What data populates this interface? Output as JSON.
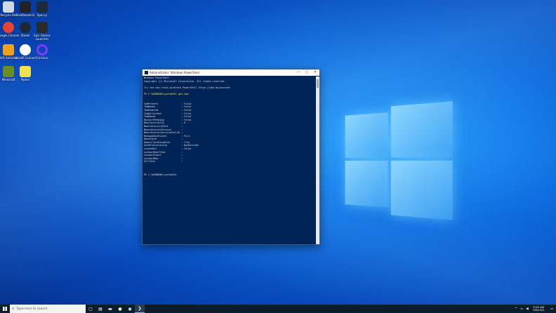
{
  "desktop": {
    "icons": [
      {
        "label": "Recycle Bin",
        "icon": "recycle-bin-icon",
        "color": "#cfd8e3"
      },
      {
        "label": "BestResearch",
        "icon": "app-icon",
        "color": "#222222"
      },
      {
        "label": "Speccy",
        "icon": "app-icon",
        "color": "#1b2a3a"
      },
      {
        "label": "Google Chrome",
        "icon": "chrome-icon",
        "color": "#e94235"
      },
      {
        "label": "Steam",
        "icon": "steam-icon",
        "color": "#1b2838"
      },
      {
        "label": "Epic Games Launcher",
        "icon": "epic-icon",
        "color": "#2a2a2a"
      },
      {
        "label": "AVG Antivirus",
        "icon": "shield-icon",
        "color": "#f0a020"
      },
      {
        "label": "Ubisoft Connect",
        "icon": "ubisoft-icon",
        "color": "#ffffff"
      },
      {
        "label": "Cortana",
        "icon": "ring-icon",
        "color": "#7a3cff"
      },
      {
        "label": "Minecraft",
        "icon": "cube-icon",
        "color": "#6b8e23"
      },
      {
        "label": "Notes",
        "icon": "file-icon",
        "color": "#f4e04d"
      }
    ]
  },
  "powershell": {
    "title": "Administrator: Windows PowerShell",
    "lines": [
      {
        "text": "Windows PowerShell",
        "style": ""
      },
      {
        "text": "Copyright (C) Microsoft Corporation. All rights reserved.",
        "style": ""
      },
      {
        "text": "",
        "style": ""
      },
      {
        "text": "Try the new cross-platform PowerShell https://aka.ms/pscore6",
        "style": ""
      },
      {
        "text": "",
        "style": ""
      },
      {
        "text": "PS C:\\WINDOWS\\system32> get-tpm",
        "style": "yel"
      },
      {
        "text": "",
        "style": ""
      },
      {
        "text": "",
        "style": ""
      },
      {
        "text": "TpmPresent                : False",
        "style": ""
      },
      {
        "text": "TpmReady                  : False",
        "style": ""
      },
      {
        "text": "TpmEnabled                : False",
        "style": ""
      },
      {
        "text": "TpmActivated              : False",
        "style": ""
      },
      {
        "text": "TpmOwned                  : False",
        "style": ""
      },
      {
        "text": "RestartPending            : False",
        "style": ""
      },
      {
        "text": "ManufacturerId            : 0",
        "style": ""
      },
      {
        "text": "ManufacturerIdTxt         :",
        "style": ""
      },
      {
        "text": "ManufacturerVersion       :",
        "style": ""
      },
      {
        "text": "ManufacturerVersionFull20 :",
        "style": ""
      },
      {
        "text": "ManagedAuthLevel          : Full",
        "style": ""
      },
      {
        "text": "OwnerAuth                 :",
        "style": ""
      },
      {
        "text": "OwnerClearDisabled        : True",
        "style": ""
      },
      {
        "text": "AutoProvisioning          : NotDefined",
        "style": ""
      },
      {
        "text": "LockedOut                 : False",
        "style": ""
      },
      {
        "text": "LockoutHealTime           :",
        "style": ""
      },
      {
        "text": "LockoutCount              :",
        "style": ""
      },
      {
        "text": "LockoutMax                :",
        "style": ""
      },
      {
        "text": "SelfTest                  :",
        "style": ""
      },
      {
        "text": "",
        "style": ""
      },
      {
        "text": "",
        "style": ""
      },
      {
        "text": "",
        "style": ""
      },
      {
        "text": "PS C:\\WINDOWS\\system32>",
        "style": ""
      }
    ]
  },
  "taskbar": {
    "search_placeholder": "Type here to search",
    "items": [
      {
        "icon": "task-view-icon",
        "glyph": "▢"
      },
      {
        "icon": "store-icon",
        "glyph": "▤"
      },
      {
        "icon": "file-explorer-icon",
        "glyph": "▬"
      },
      {
        "icon": "chrome-icon",
        "glyph": "●"
      },
      {
        "icon": "steam-icon",
        "glyph": "◉"
      },
      {
        "icon": "powershell-icon",
        "glyph": "❯"
      }
    ],
    "tray": {
      "chevron": "^",
      "network": "▭",
      "volume": "◀",
      "time": "9:55 AM",
      "date": "7/6/2021"
    }
  }
}
